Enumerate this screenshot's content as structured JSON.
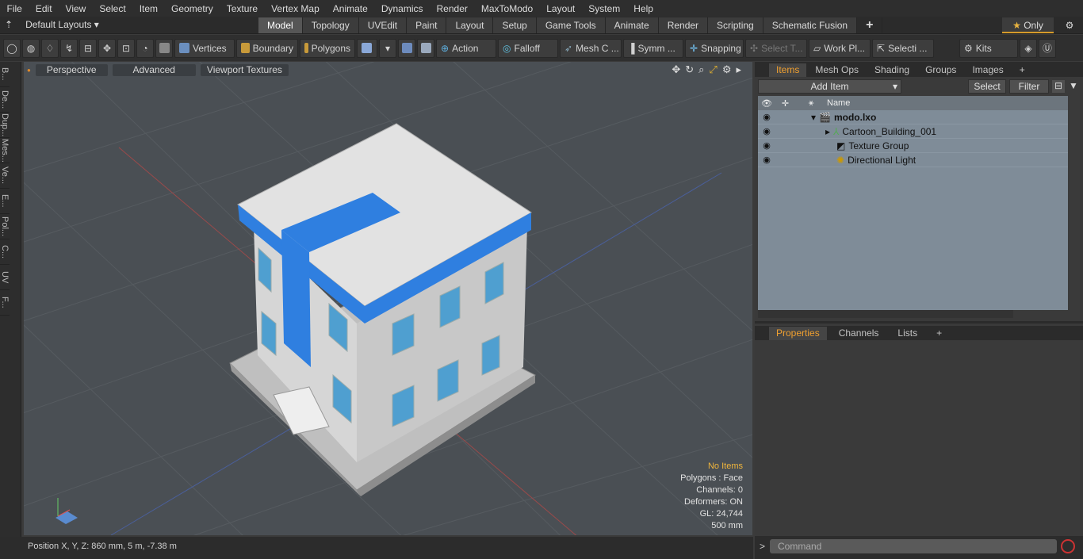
{
  "menu": [
    "File",
    "Edit",
    "View",
    "Select",
    "Item",
    "Geometry",
    "Texture",
    "Vertex Map",
    "Animate",
    "Dynamics",
    "Render",
    "MaxToModo",
    "Layout",
    "System",
    "Help"
  ],
  "layout_label": "Default Layouts",
  "tabs": [
    "Model",
    "Topology",
    "UVEdit",
    "Paint",
    "Layout",
    "Setup",
    "Game Tools",
    "Animate",
    "Render",
    "Scripting",
    "Schematic Fusion"
  ],
  "only_label": "Only",
  "toolbar": {
    "vertices": "Vertices",
    "boundary": "Boundary",
    "polygons": "Polygons",
    "action": "Action",
    "falloff": "Falloff",
    "mesh": "Mesh C ...",
    "symm": "Symm ...",
    "snapping": "Snapping",
    "select_t": "Select T...",
    "work_pl": "Work Pl...",
    "selecti": "Selecti ...",
    "kits": "Kits"
  },
  "left_tabs": [
    "B...",
    "De...",
    "Dup...",
    "Mes...",
    "Ve...",
    "E...",
    "Pol...",
    "C...",
    "UV",
    "F..."
  ],
  "viewport": {
    "perspective": "Perspective",
    "advanced": "Advanced",
    "textures": "Viewport Textures"
  },
  "stats": {
    "items": "No Items",
    "polygons": "Polygons : Face",
    "channels": "Channels: 0",
    "deformers": "Deformers: ON",
    "gl": "GL: 24,744",
    "scale": "500 mm"
  },
  "status": "Position X, Y, Z:   860 mm, 5 m, -7.38 m",
  "panel_tabs": [
    "Items",
    "Mesh Ops",
    "Shading",
    "Groups",
    "Images"
  ],
  "add_item": "Add Item",
  "select_btn": "Select",
  "filter_btn": "Filter",
  "name_col": "Name",
  "items": [
    "modo.lxo",
    "Cartoon_Building_001",
    "Texture Group",
    "Directional Light"
  ],
  "props_tabs": [
    "Properties",
    "Channels",
    "Lists"
  ],
  "command_placeholder": "Command",
  "colors": {
    "accent": "#f0a030",
    "building_blue": "#2f7fe0",
    "window_blue": "#4f9fd0"
  }
}
